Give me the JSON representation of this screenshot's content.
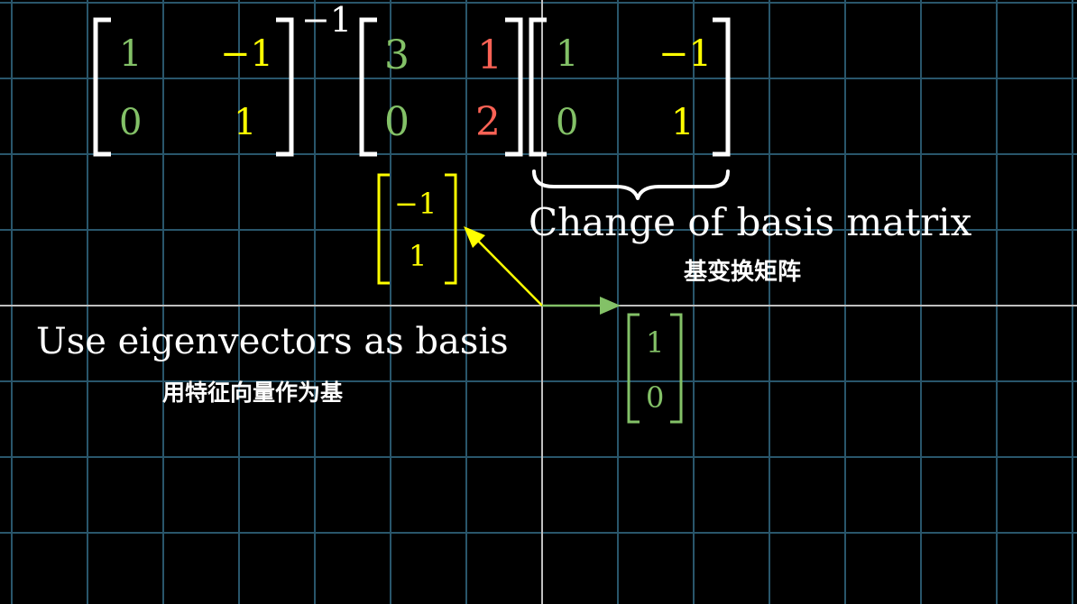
{
  "colors": {
    "background": "#000000",
    "grid": "#29566b",
    "axis": "#bfbfbf",
    "white": "#ffffff",
    "green": "#83c167",
    "yellow": "#ffff00",
    "red": "#fc6255"
  },
  "equation": {
    "inverse_matrix": [
      [
        "1",
        "−1"
      ],
      [
        "0",
        "1"
      ]
    ],
    "inverse_exponent": "−1",
    "transform_matrix": [
      [
        "3",
        "1"
      ],
      [
        "0",
        "2"
      ]
    ],
    "basis_matrix": [
      [
        "1",
        "−1"
      ],
      [
        "0",
        "1"
      ]
    ]
  },
  "brace_label": {
    "english": "Change of basis matrix",
    "chinese": "基变换矩阵"
  },
  "eigen_label": {
    "english": "Use eigenvectors as basis",
    "chinese": "用特征向量作为基"
  },
  "vectors": {
    "yellow_vector": [
      "−1",
      "1"
    ],
    "green_vector": [
      "1",
      "0"
    ]
  }
}
